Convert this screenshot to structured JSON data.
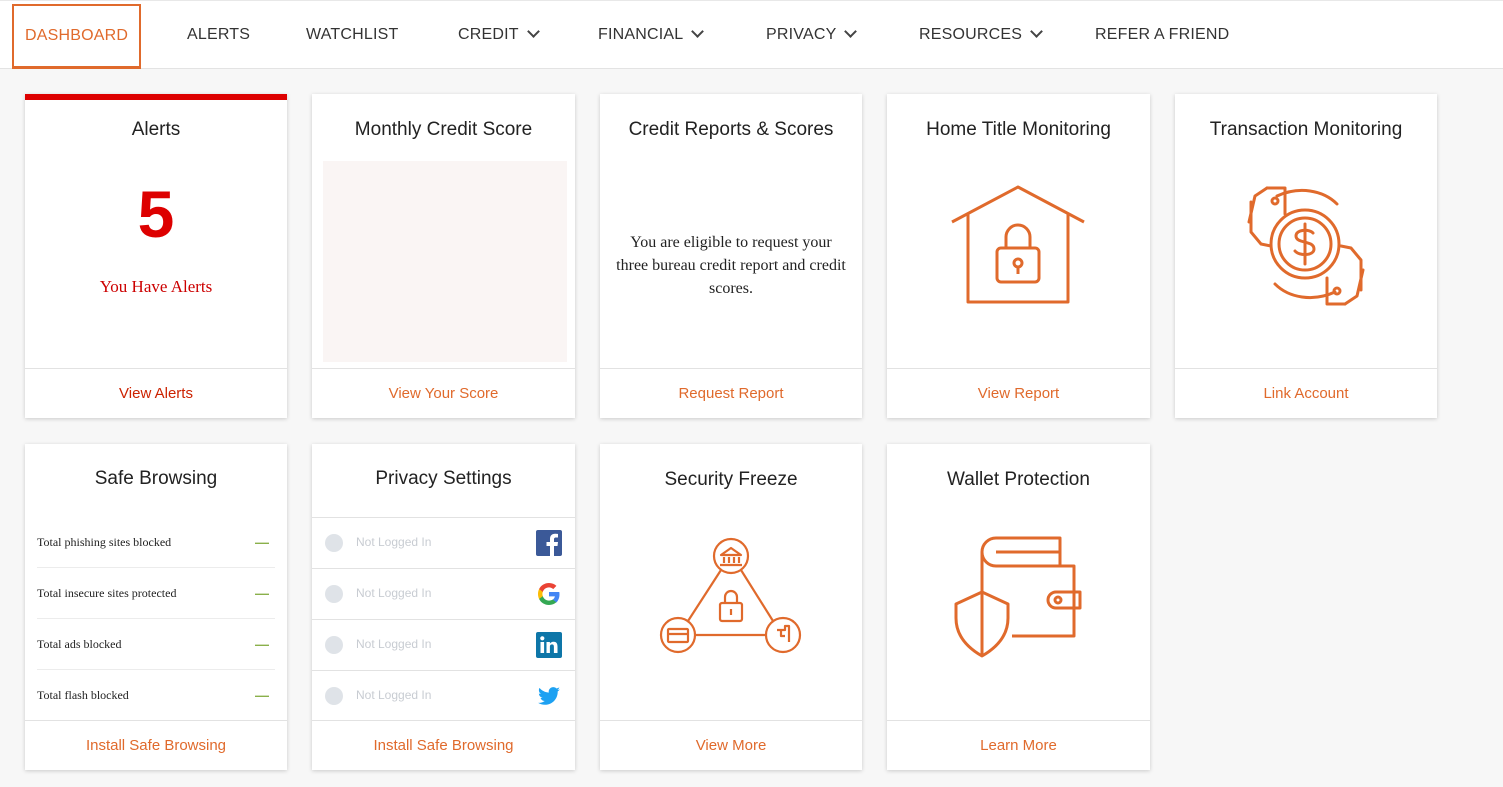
{
  "nav": {
    "items": [
      {
        "label": "DASHBOARD"
      },
      {
        "label": "ALERTS"
      },
      {
        "label": "WATCHLIST"
      },
      {
        "label": "CREDIT"
      },
      {
        "label": "FINANCIAL"
      },
      {
        "label": "PRIVACY"
      },
      {
        "label": "RESOURCES"
      },
      {
        "label": "REFER A FRIEND"
      }
    ],
    "active": "DASHBOARD"
  },
  "cards": {
    "alerts": {
      "title": "Alerts",
      "count": "5",
      "message": "You Have Alerts",
      "footer": "View Alerts"
    },
    "monthly_score": {
      "title": "Monthly Credit Score",
      "footer": "View Your Score"
    },
    "credit_reports": {
      "title": "Credit Reports & Scores",
      "message": "You are eligible to request your three bureau credit report and credit scores.",
      "footer": "Request Report"
    },
    "home_title": {
      "title": "Home Title Monitoring",
      "icon": "house-lock-icon",
      "footer": "View Report"
    },
    "transaction": {
      "title": "Transaction Monitoring",
      "icon": "hands-dollar-coin-icon",
      "footer": "Link Account"
    },
    "safe_browsing": {
      "title": "Safe Browsing",
      "rows": [
        {
          "label": "Total phishing sites blocked",
          "value": "—"
        },
        {
          "label": "Total insecure sites protected",
          "value": "—"
        },
        {
          "label": "Total ads blocked",
          "value": "—"
        },
        {
          "label": "Total flash blocked",
          "value": "—"
        }
      ],
      "footer": "Install Safe Browsing"
    },
    "privacy_settings": {
      "title": "Privacy Settings",
      "rows": [
        {
          "label": "Not Logged In",
          "network": "facebook-icon"
        },
        {
          "label": "Not Logged In",
          "network": "google-icon"
        },
        {
          "label": "Not Logged In",
          "network": "linkedin-icon"
        },
        {
          "label": "Not Logged In",
          "network": "twitter-icon"
        }
      ],
      "footer": "Install Safe Browsing"
    },
    "security_freeze": {
      "title": "Security Freeze",
      "icon": "freeze-network-icon",
      "footer": "View More"
    },
    "wallet": {
      "title": "Wallet Protection",
      "icon": "wallet-shield-icon",
      "footer": "Learn More"
    }
  },
  "colors": {
    "accent": "#e06a2c",
    "alert": "#dd0000",
    "positive": "#8ab04b",
    "muted": "#c8ccd2"
  }
}
